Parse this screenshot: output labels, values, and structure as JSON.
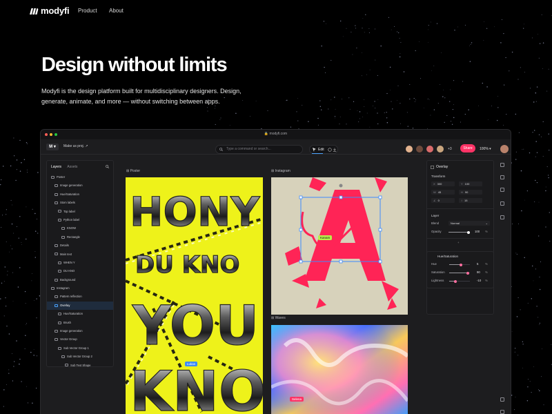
{
  "nav": {
    "brand": "modyfi",
    "links": [
      "Product",
      "About"
    ]
  },
  "hero": {
    "title": "Design without limits",
    "subtitle": "Modyfi is the design platform built for multidisciplinary designers. Design, generate, animate, and more — without switching between apps."
  },
  "app": {
    "url": "modyfi.com",
    "project_name": "Make us proj. ↗",
    "search_placeholder": "Type a command or search...",
    "edit_label": "Edit",
    "collaborator_count": "+3",
    "share_label": "Share",
    "zoom": "100%",
    "colors": {
      "accent": "#ff3366",
      "selection": "#4aa3ff",
      "poster_bg": "#eef21a",
      "insta_bg": "#d7d2bb"
    },
    "left_panel": {
      "tabs": [
        "Layers",
        "Assets"
      ],
      "layers": [
        "Poster",
        "Image generation",
        "Hue/Saturation",
        "Stom labels",
        "Top label",
        "Python label",
        "KNOW",
        "Rectangle",
        "Details",
        "Main text",
        "WHEN Y",
        "DU KNO",
        "Background",
        "Instagram",
        "Pattern reflection",
        "Overlay",
        "Hue/Saturation",
        "Brush",
        "Image generation",
        "Vector Group",
        "Sub Vector Group 1",
        "Sub Vector Group 2",
        "Sub Text Shape"
      ],
      "selected_index": 15
    },
    "canvas": {
      "frames": [
        "Poster",
        "Instagram",
        "Waves"
      ],
      "tags": [
        "Kanam",
        "Lukas",
        "Selena"
      ],
      "poster_text": [
        "HONY",
        "DU KNO",
        "YOU",
        "KNO"
      ]
    },
    "right_panel": {
      "title": "Overlay",
      "transform_label": "Transform",
      "transform_fields": [
        {
          "k": "X",
          "v": "300"
        },
        {
          "k": "Y",
          "v": "100"
        },
        {
          "k": "W",
          "v": "45"
        },
        {
          "k": "H",
          "v": "90"
        },
        {
          "k": "∠",
          "v": "0"
        },
        {
          "k": "↕",
          "v": "15"
        }
      ],
      "layer_label": "Layer",
      "blend_label": "Blend",
      "blend_value": "Normal",
      "opacity_label": "Opacity",
      "opacity_value": "100",
      "opacity_unit": "%",
      "opacity_fraction": 0.95,
      "adjust_title": "Hue/Saturation",
      "adjustments": [
        {
          "label": "Hue",
          "value": "5",
          "unit": "%",
          "fraction": 0.55
        },
        {
          "label": "Saturation",
          "value": "90",
          "unit": "%",
          "fraction": 0.9
        },
        {
          "label": "Lightness",
          "value": "-10",
          "unit": "%",
          "fraction": 0.3
        }
      ]
    }
  }
}
